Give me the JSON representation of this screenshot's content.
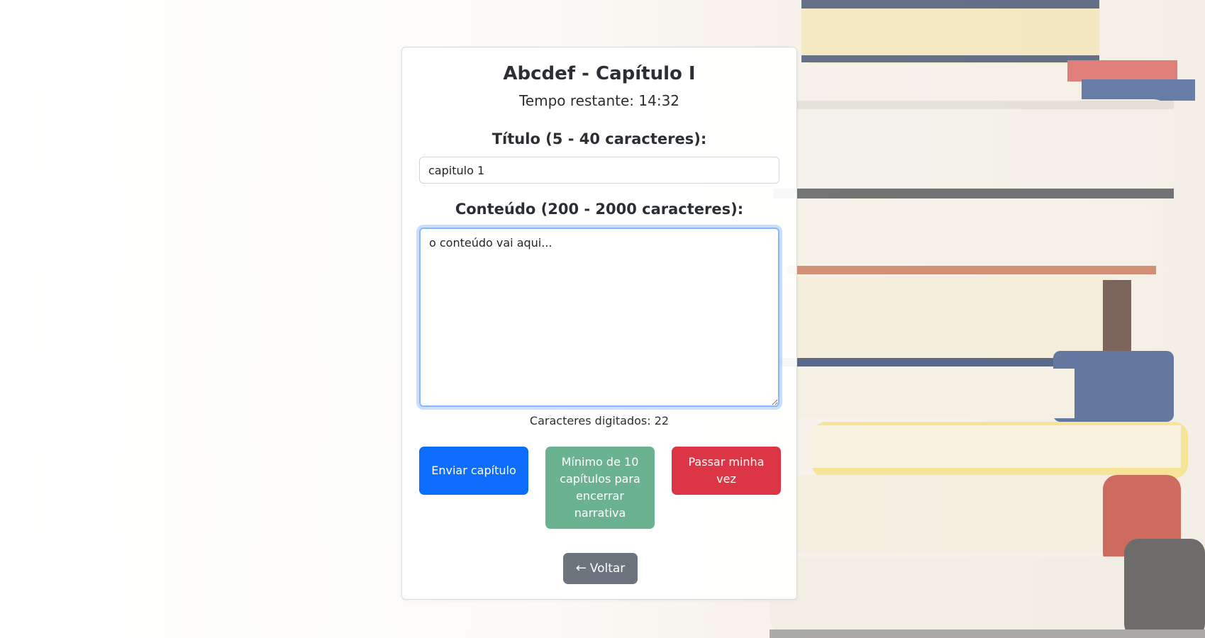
{
  "page": {
    "title": "Abcdef - Capítulo I",
    "timer_text": "Tempo restante: 14:32"
  },
  "form": {
    "title_label": "Título (5 - 40 caracteres):",
    "title_value": "capitulo 1",
    "content_label": "Conteúdo (200 - 2000 caracteres):",
    "content_value": "o conteúdo vai aqui...",
    "counter_text": "Caracteres digitados: 22"
  },
  "buttons": {
    "send": "Enviar capítulo",
    "end": "Mínimo de 10 capítulos para encerrar narrativa",
    "pass": "Passar minha vez",
    "back": "Voltar",
    "back_icon": "arrow-left-icon"
  },
  "colors": {
    "primary": "#0d6efd",
    "success_disabled": "#6bb390",
    "danger": "#dc3545",
    "secondary": "#6c757d",
    "focus_border": "#86b7fe"
  }
}
